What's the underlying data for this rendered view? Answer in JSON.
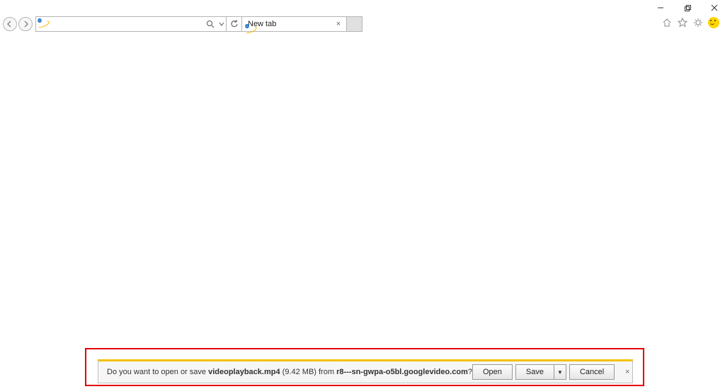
{
  "window_controls": {
    "minimize_tooltip": "Minimize",
    "maximize_tooltip": "Restore",
    "close_tooltip": "Close"
  },
  "toolbar": {
    "back_tooltip": "Back",
    "forward_tooltip": "Forward",
    "address_value": "",
    "search_tooltip": "Search",
    "dropdown_tooltip": "Show address bar autocomplete",
    "refresh_tooltip": "Refresh"
  },
  "tabs": [
    {
      "title": "New tab",
      "close_tooltip": "Close tab"
    }
  ],
  "newtab_tooltip": "New tab",
  "right_icons": {
    "home_tooltip": "Home",
    "favorites_tooltip": "Favorites",
    "tools_tooltip": "Tools",
    "feedback_tooltip": "Feedback"
  },
  "download_bar": {
    "prompt_prefix": "Do you want to open or save ",
    "filename": "videoplayback.mp4",
    "filesize": " (9.42 MB) ",
    "from_word": "from ",
    "host": "r8---sn-gwpa-o5bl.googlevideo.com",
    "suffix": "?",
    "open_label": "Open",
    "save_label": "Save",
    "save_arrow_tooltip": "Save options",
    "cancel_label": "Cancel",
    "close_tooltip": "Close"
  }
}
